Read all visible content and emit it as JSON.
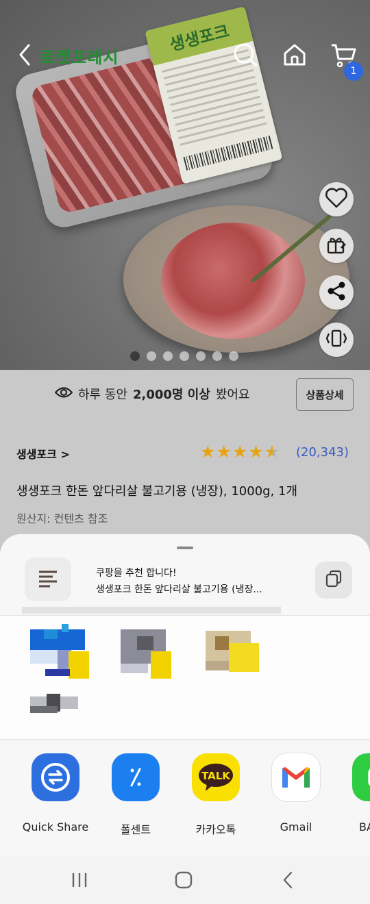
{
  "topbar": {
    "brand": "로켓프레시",
    "cart_count": "1",
    "icons": [
      "back-arrow-icon",
      "search-icon",
      "home-icon",
      "cart-icon"
    ]
  },
  "hero": {
    "label_brand": "생생포크",
    "side_actions": [
      "heart-icon",
      "gift-icon",
      "share-icon",
      "vibrate-icon"
    ],
    "image_pages": 7,
    "active_page": 1
  },
  "views": {
    "prefix": "하루 동안",
    "count": "2,000명 이상",
    "suffix": "봤어요",
    "detail_button": "상품상세"
  },
  "product": {
    "brand": "생생포크 >",
    "rating": 4.5,
    "review_count": "(20,343)",
    "title": "생생포크 한돈 앞다리살 불고기용 (냉장), 1000g, 1개",
    "origin": "원산지: 컨텐츠 참조"
  },
  "share_sheet": {
    "message_line1": "쿠팡을 추천 합니다!",
    "message_line2": "생생포크 한돈 앞다리살 불고기용 (냉장...",
    "apps": [
      {
        "label": "Quick Share",
        "icon": "quick-share-icon",
        "color": "#2e6fe0"
      },
      {
        "label": "폴센트",
        "icon": "polcent-icon",
        "color": "#1b7ff0"
      },
      {
        "label": "카카오톡",
        "icon": "kakaotalk-icon",
        "color": "#f9e000"
      },
      {
        "label": "Gmail",
        "icon": "gmail-icon",
        "color": "#ffffff"
      },
      {
        "label": "BA",
        "icon": "band-icon",
        "color": "#2ecc40"
      }
    ]
  },
  "colors": {
    "brand_green": "#1e8f2e",
    "link_blue": "#3a5bbf",
    "star": "#e6a312",
    "badge": "#2f67e0"
  }
}
